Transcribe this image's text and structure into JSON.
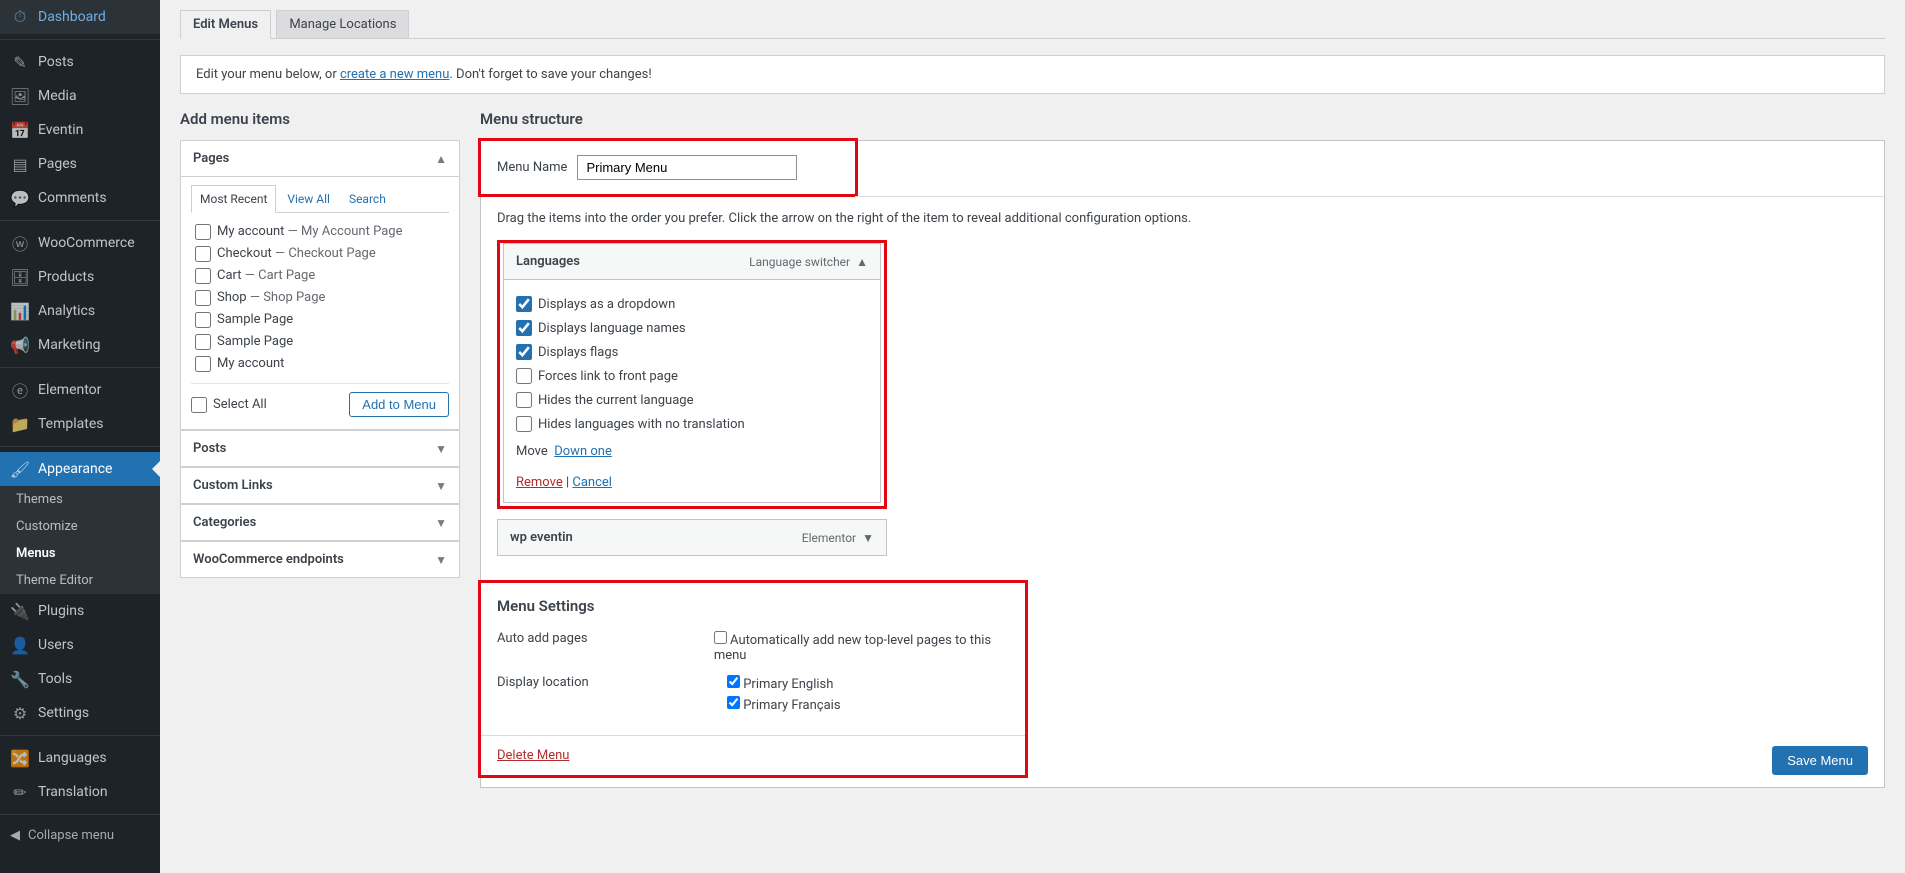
{
  "sidebar": {
    "items": [
      {
        "label": "Dashboard",
        "icon": "⏱"
      },
      {
        "label": "Posts",
        "icon": "✎"
      },
      {
        "label": "Media",
        "icon": "🖼"
      },
      {
        "label": "Eventin",
        "icon": "📅"
      },
      {
        "label": "Pages",
        "icon": "▤"
      },
      {
        "label": "Comments",
        "icon": "💬"
      },
      {
        "label": "WooCommerce",
        "icon": "ⓦ"
      },
      {
        "label": "Products",
        "icon": "🗄"
      },
      {
        "label": "Analytics",
        "icon": "📊"
      },
      {
        "label": "Marketing",
        "icon": "📢"
      },
      {
        "label": "Elementor",
        "icon": "ⓔ"
      },
      {
        "label": "Templates",
        "icon": "📁"
      },
      {
        "label": "Appearance",
        "icon": "🖌"
      },
      {
        "label": "Plugins",
        "icon": "🔌"
      },
      {
        "label": "Users",
        "icon": "👤"
      },
      {
        "label": "Tools",
        "icon": "🔧"
      },
      {
        "label": "Settings",
        "icon": "⚙"
      },
      {
        "label": "Languages",
        "icon": "🔀"
      },
      {
        "label": "Translation",
        "icon": "✏"
      }
    ],
    "subs": [
      "Themes",
      "Customize",
      "Menus",
      "Theme Editor"
    ],
    "collapse": "Collapse menu"
  },
  "tabs": {
    "edit": "Edit Menus",
    "manage": "Manage Locations"
  },
  "notice": {
    "pre": "Edit your menu below, or ",
    "link": "create a new menu",
    "post": ". Don't forget to save your changes!"
  },
  "left": {
    "heading": "Add menu items",
    "pages_box": "Pages",
    "subtabs": {
      "recent": "Most Recent",
      "all": "View All",
      "search": "Search"
    },
    "items": [
      {
        "t": "My account",
        "s": " — My Account Page"
      },
      {
        "t": "Checkout",
        "s": " — Checkout Page"
      },
      {
        "t": "Cart",
        "s": " — Cart Page"
      },
      {
        "t": "Shop",
        "s": " — Shop Page"
      },
      {
        "t": "Sample Page",
        "s": ""
      },
      {
        "t": "Sample Page",
        "s": ""
      },
      {
        "t": "My account",
        "s": ""
      }
    ],
    "select_all": "Select All",
    "add_btn": "Add to Menu",
    "collapsed": [
      "Posts",
      "Custom Links",
      "Categories",
      "WooCommerce endpoints"
    ]
  },
  "right": {
    "heading": "Menu structure",
    "name_label": "Menu Name",
    "name_value": "Primary Menu",
    "drag_hint": "Drag the items into the order you prefer. Click the arrow on the right of the item to reveal additional configuration options.",
    "lang_item": {
      "title": "Languages",
      "type": "Language switcher",
      "opts": [
        {
          "l": "Displays as a dropdown",
          "c": true
        },
        {
          "l": "Displays language names",
          "c": true
        },
        {
          "l": "Displays flags",
          "c": true
        },
        {
          "l": "Forces link to front page",
          "c": false
        },
        {
          "l": "Hides the current language",
          "c": false
        },
        {
          "l": "Hides languages with no translation",
          "c": false
        }
      ],
      "move_label": "Move",
      "move_link": "Down one",
      "remove": "Remove",
      "cancel": "Cancel"
    },
    "second_item": {
      "title": "wp eventin",
      "type": "Elementor"
    },
    "settings": {
      "heading": "Menu Settings",
      "auto_label": "Auto add pages",
      "auto_opt": "Automatically add new top-level pages to this menu",
      "loc_label": "Display location",
      "loc_opts": [
        {
          "l": "Primary English",
          "c": true
        },
        {
          "l": "Primary Français",
          "c": true
        }
      ]
    },
    "delete": "Delete Menu",
    "save": "Save Menu"
  }
}
